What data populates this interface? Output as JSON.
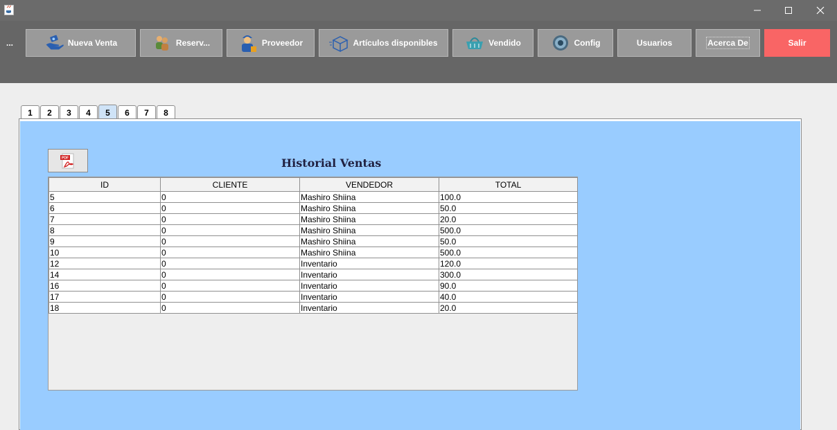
{
  "window": {
    "minimize_glyph": "—",
    "maximize_glyph": "☐",
    "close_glyph": "✕"
  },
  "toolbar": {
    "more_label": "...",
    "buttons": [
      {
        "label": "Nueva Venta",
        "icon": "hand-money-icon"
      },
      {
        "label": "Reserv...",
        "icon": "people-icon"
      },
      {
        "label": "Proveedor",
        "icon": "delivery-man-icon"
      },
      {
        "label": "Artículos disponibles",
        "icon": "box-icon"
      },
      {
        "label": "Vendido",
        "icon": "basket-icon"
      },
      {
        "label": "Config",
        "icon": "gear-icon"
      },
      {
        "label": "Usuarios",
        "icon": ""
      },
      {
        "label": "Acerca De",
        "icon": ""
      },
      {
        "label": "Salir",
        "icon": ""
      }
    ]
  },
  "tabs": [
    "1",
    "2",
    "3",
    "4",
    "5",
    "6",
    "7",
    "8"
  ],
  "active_tab": "5",
  "historial": {
    "title": "Historial Ventas",
    "pdf_icon": "pdf-icon",
    "columns": [
      "ID",
      "CLIENTE",
      "VENDEDOR",
      "TOTAL"
    ],
    "rows": [
      [
        "5",
        "0",
        "Mashiro Shiina",
        "100.0"
      ],
      [
        "6",
        "0",
        "Mashiro Shiina",
        "50.0"
      ],
      [
        "7",
        "0",
        "Mashiro Shiina",
        "20.0"
      ],
      [
        "8",
        "0",
        "Mashiro Shiina",
        "500.0"
      ],
      [
        "9",
        "0",
        "Mashiro Shiina",
        "50.0"
      ],
      [
        "10",
        "0",
        "Mashiro Shiina",
        "500.0"
      ],
      [
        "12",
        "0",
        "Inventario",
        "120.0"
      ],
      [
        "14",
        "0",
        "Inventario",
        "300.0"
      ],
      [
        "16",
        "0",
        "Inventario",
        "90.0"
      ],
      [
        "17",
        "0",
        "Inventario",
        "40.0"
      ],
      [
        "18",
        "0",
        "Inventario",
        "20.0"
      ]
    ]
  },
  "colors": {
    "titlebar": "#6b6b6b",
    "toolbar": "#666666",
    "button": "#9a9a9a",
    "salir": "#f96565",
    "panel": "#99ccff"
  }
}
